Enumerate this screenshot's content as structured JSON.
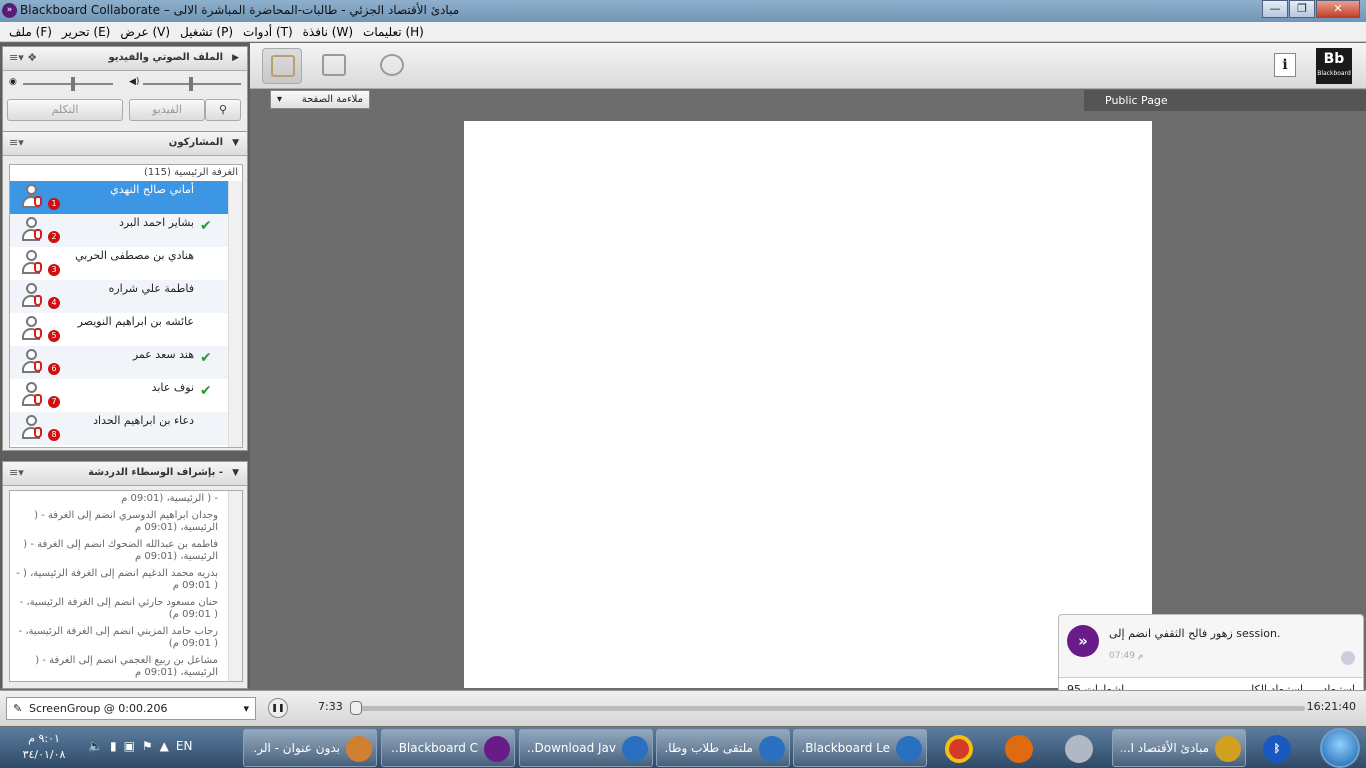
{
  "window": {
    "title": "Blackboard Collaborate – مبادئ الأقتصاد الجزئي - طالبات-المحاضرة المباشرة الالى",
    "minimize": "—",
    "maximize": "❐",
    "close": "✕"
  },
  "menu": [
    "ملف (F)",
    "تحرير (E)",
    "عرض (V)",
    "تشغيل (P)",
    "أدوات (T)",
    "نافذة (W)",
    "تعليمات (H)"
  ],
  "av": {
    "title": "الملف الصوتي والفيديو",
    "video_btn": "الفيديو",
    "talk_btn": "التكلم"
  },
  "participants": {
    "title": "المشاركون",
    "room": "الغرفة الرئيسية (115)",
    "items": [
      {
        "name": "أماني صالح النهدي",
        "num": "1",
        "check": ""
      },
      {
        "name": "بشاير احمد البرد",
        "num": "2",
        "check": "✔"
      },
      {
        "name": "هنادي بن مصطفى الحربي",
        "num": "3",
        "check": ""
      },
      {
        "name": "فاطمة علي شراره",
        "num": "4",
        "check": ""
      },
      {
        "name": "عائشه بن ابراهيم النويصر",
        "num": "5",
        "check": ""
      },
      {
        "name": "هند سعد عمر",
        "num": "6",
        "check": "✔"
      },
      {
        "name": "نوف عابد",
        "num": "7",
        "check": "✔"
      },
      {
        "name": "دعاء بن ابراهيم الحداد",
        "num": "8",
        "check": ""
      }
    ]
  },
  "chat": {
    "title": "- بإشراف الوسطاء الدردشة",
    "messages": [
      "- ( الرئيسية، (09:01 م",
      "وجدان ابراهيم الدوسري انضم إلى الغرفة - ( الرئيسية، (09:01 م",
      "فاطمه بن عبدالله الضحوك انضم إلى الغرفة - ( الرئيسية، (09:01 م",
      "بدريه محمد الدغيم انضم إلى الغرفة الرئيسية، ( - ( 09:01 م",
      "حنان مسعود حارثي انضم إلى الغرفة الرئيسية، - ( 09:01 م)",
      "رحاب حامد المزيني انضم إلى الغرفة الرئيسية، - ( 09:01 م)",
      "مشاعل بن ربيع العجمي انضم إلى الغرفة - ( الرئيسية، (09:01 م"
    ]
  },
  "toolbar": {
    "fit": "ملاءمة الصفحة",
    "public_page": "Public Page",
    "info": "i",
    "logo": "Bb",
    "logo_sub": "Blackboard"
  },
  "notification": {
    "text": "زهور فالح الثقفي انضم إلى session.",
    "time": "07:49 م",
    "count": "95 إشعارات",
    "clear_all": "استبعاد الكل",
    "clear": "استبعاد"
  },
  "playback": {
    "recording": "ScreenGroup @ 0:00.206",
    "current": "7:33",
    "end": "16:21:40",
    "progress_fraction": 0.0
  },
  "taskbar": {
    "clock_time": "٩:٠١ م",
    "clock_date": "٣٤/٠١/٠٨",
    "lang": "EN",
    "items": [
      {
        "label": "بدون عنوان - الر...",
        "color": "#d08030"
      },
      {
        "label": "Blackboard C...",
        "color": "#6a1b8a"
      },
      {
        "label": "Download Jav...",
        "color": "#2a70c0"
      },
      {
        "label": "ملتقى طلاب وطا...",
        "color": "#2a70c0"
      },
      {
        "label": "Blackboard Le...",
        "color": "#2a70c0"
      },
      {
        "label": "مبادئ الأقتصاد ا...",
        "color": "#d0a020"
      }
    ]
  }
}
